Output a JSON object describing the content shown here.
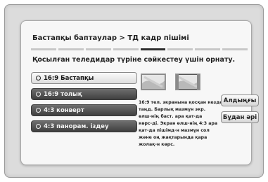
{
  "header": {
    "breadcrumb": "Бастапқы баптаулар > ТД кадр пішімі"
  },
  "step_count": 8,
  "active_step": 5,
  "instruction": "Қосылған теледидар түріне сәйкестеу үшін орнату.",
  "options": [
    {
      "label": "16:9 Бастапқы",
      "selected": true
    },
    {
      "label": "16:9 толық",
      "selected": false
    },
    {
      "label": "4:3 конверт",
      "selected": false
    },
    {
      "label": "4:3 панорам. іздеу",
      "selected": false
    }
  ],
  "preview_icons": [
    "tv-frame-icon",
    "tv-frame-icon"
  ],
  "description_lines": [
    "16:9 тел. экранына қосқан кезде",
    " таңд. Барлық мазмұн экр.",
    "өлш-нің баст. ара қат-да",
    "көрс-ді. Экран өлш-нің 4:3 ара",
    "қат-да пішімд-н мазмұн сол",
    "және оң жақтарында қара",
    "жолақ-н көрс."
  ],
  "buttons": {
    "previous": "Алдыңғы",
    "next": "Бұдан әрі"
  }
}
